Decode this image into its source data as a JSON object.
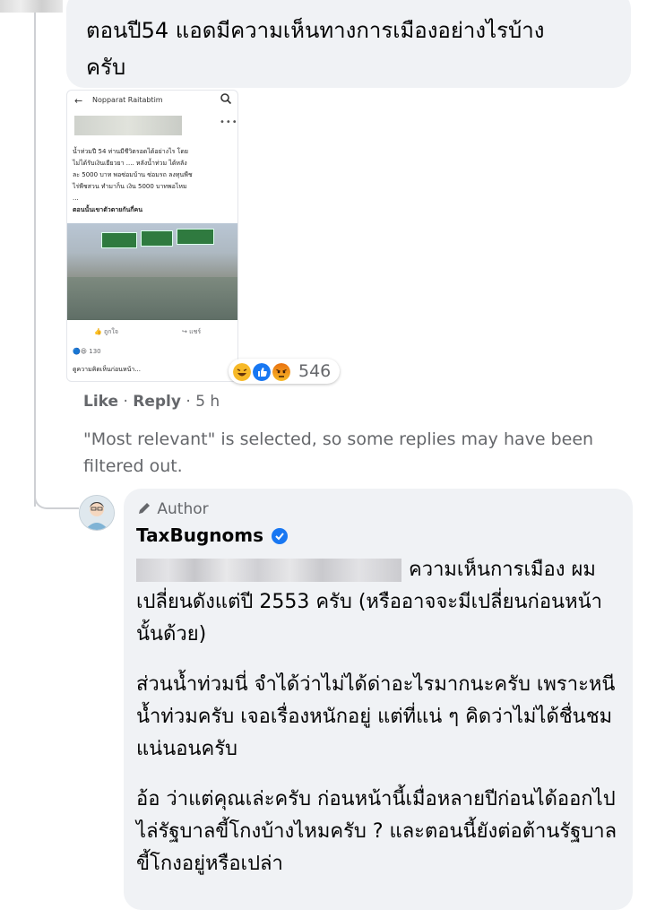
{
  "parent_comment": {
    "text_line1": "ตอนปี54 แอดมีความเห็นทางการเมืองอย่างไรบ้าง",
    "text_line2": "ครับ"
  },
  "embedded_screenshot": {
    "back_icon": "arrow-left-icon",
    "profile_name": "Nopparat Raitabtim",
    "search_icon": "search-icon",
    "more_icon": "ellipsis-icon",
    "post_lines": [
      "น้ำท่วมปี 54 ท่านมีชีวิตรอดได้อย่างไร โดย",
      "ไม่ได้รับเงินเยียวยา .... หลังน้ำท่วม ได้หลัง",
      "ละ 5000 บาท พอซ่อมบ้าน ซ่อมรถ ลงทุนพืช",
      "ไร่พืชสวน ทำมาก็น เงิน 5000 บาทพอไหม",
      "...",
      "ตอนนั้นเขาตัวตายกันกี่คน"
    ],
    "like_label": "ถูกใจ",
    "share_label": "แชร์",
    "reaction_count": "130",
    "comment_preview": "ดูความคิดเห็นก่อนหน้า..."
  },
  "reactions": {
    "icons": [
      "haha-icon",
      "like-icon",
      "angry-icon"
    ],
    "count": "546"
  },
  "parent_actions": {
    "like": "Like",
    "separator": "·",
    "reply": "Reply",
    "time": "5 h"
  },
  "filter_note": "\"Most relevant\" is selected, so some replies may have been filtered out.",
  "reply": {
    "badge_icon": "pencil-icon",
    "badge": "Author",
    "author": "TaxBugnoms",
    "verified_icon": "verified-badge-icon",
    "para1_visible": "ความเห็นการเมือง ผมเปลี่ยนดังแต่ปี 2553 ครับ (หรืออาจจะมีเปลี่ยนก่อนหน้านั้นด้วย)",
    "para2": "ส่วนน้ำท่วมนี่ จำได้ว่าไม่ได้ด่าอะไรมากนะครับ เพราะหนีน้ำท่วมครับ เจอเรื่องหนักอยู่ แต่ที่แน่ ๆ คิดว่าไม่ได้ชื่นชมแน่นอนครับ",
    "para3": "อ้อ ว่าแต่คุณเล่ะครับ ก่อนหน้านี้เมื่อหลายปีก่อนได้ออกไปไล่รัฐบาลขี้โกงบ้างไหมครับ ? และตอนนี้ยังต่อต้านรัฐบาลขี้โกงอยู่หรือเปล่า"
  }
}
